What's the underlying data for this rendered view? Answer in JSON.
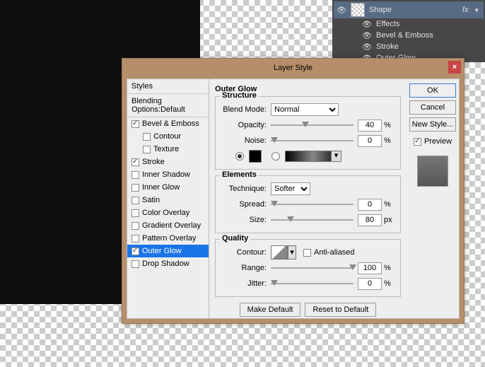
{
  "layers_panel": {
    "layer_name": "Shape",
    "fx_label": "fx",
    "effects": "Effects",
    "items": [
      "Bevel & Emboss",
      "Stroke",
      "Outer Glow"
    ]
  },
  "dialog": {
    "title": "Layer Style",
    "close": "×",
    "sidebar": {
      "styles": "Styles",
      "blending": "Blending Options:Default",
      "items": [
        {
          "label": "Bevel & Emboss",
          "checked": true,
          "sub": false
        },
        {
          "label": "Contour",
          "checked": false,
          "sub": true
        },
        {
          "label": "Texture",
          "checked": false,
          "sub": true
        },
        {
          "label": "Stroke",
          "checked": true,
          "sub": false
        },
        {
          "label": "Inner Shadow",
          "checked": false,
          "sub": false
        },
        {
          "label": "Inner Glow",
          "checked": false,
          "sub": false
        },
        {
          "label": "Satin",
          "checked": false,
          "sub": false
        },
        {
          "label": "Color Overlay",
          "checked": false,
          "sub": false
        },
        {
          "label": "Gradient Overlay",
          "checked": false,
          "sub": false
        },
        {
          "label": "Pattern Overlay",
          "checked": false,
          "sub": false
        },
        {
          "label": "Outer Glow",
          "checked": true,
          "sub": false,
          "selected": true
        },
        {
          "label": "Drop Shadow",
          "checked": false,
          "sub": false
        }
      ]
    },
    "section_title": "Outer Glow",
    "structure": {
      "legend": "Structure",
      "blend_mode_label": "Blend Mode:",
      "blend_mode_value": "Normal",
      "opacity_label": "Opacity:",
      "opacity_value": "40",
      "opacity_unit": "%",
      "noise_label": "Noise:",
      "noise_value": "0",
      "noise_unit": "%"
    },
    "elements": {
      "legend": "Elements",
      "technique_label": "Technique:",
      "technique_value": "Softer",
      "spread_label": "Spread:",
      "spread_value": "0",
      "spread_unit": "%",
      "size_label": "Size:",
      "size_value": "80",
      "size_unit": "px"
    },
    "quality": {
      "legend": "Quality",
      "contour_label": "Contour:",
      "anti_aliased": "Anti-aliased",
      "range_label": "Range:",
      "range_value": "100",
      "range_unit": "%",
      "jitter_label": "Jitter:",
      "jitter_value": "0",
      "jitter_unit": "%"
    },
    "make_default": "Make Default",
    "reset_default": "Reset to Default",
    "ok": "OK",
    "cancel": "Cancel",
    "new_style": "New Style...",
    "preview": "Preview"
  }
}
